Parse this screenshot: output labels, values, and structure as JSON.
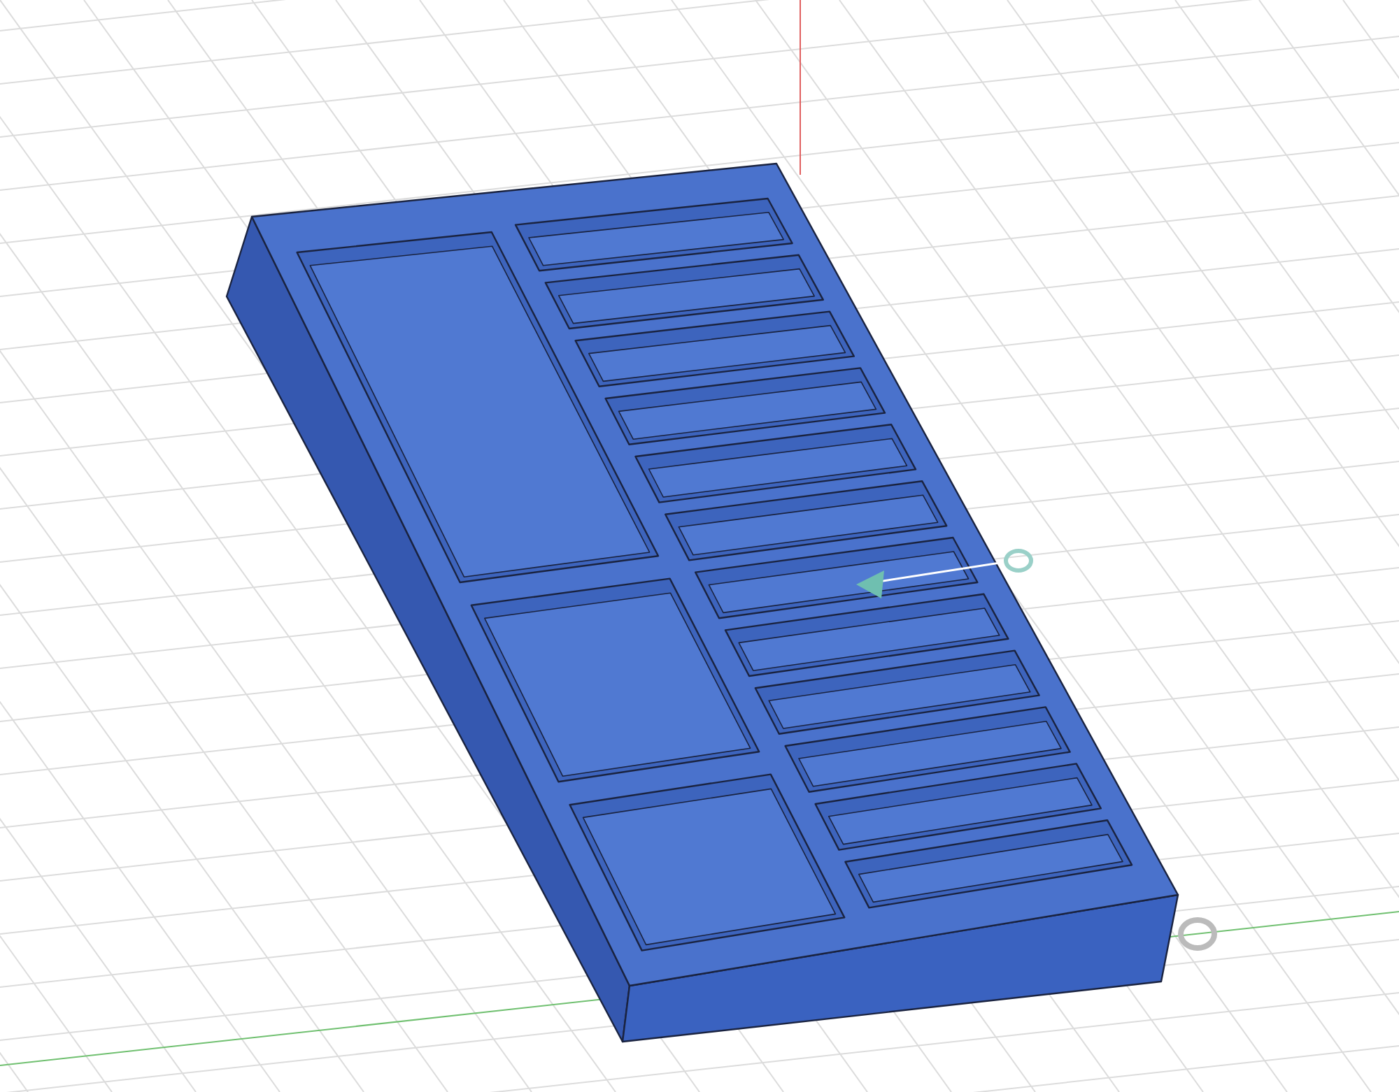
{
  "viewport": {
    "grid": true,
    "origin_axes": true,
    "manipulator": true
  }
}
